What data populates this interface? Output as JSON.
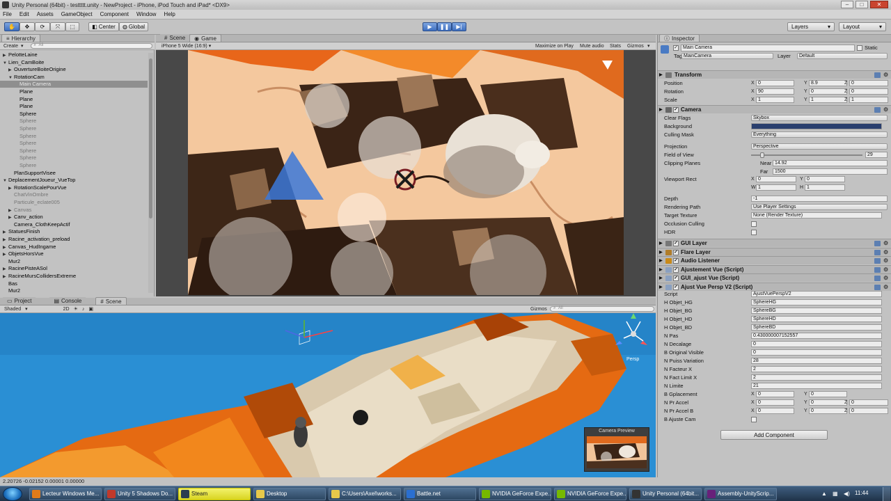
{
  "window": {
    "title": "Unity Personal (64bit) - testtttt.unity - NewProject - iPhone, iPod Touch and iPad* <DX9>",
    "controls": [
      "–",
      "□",
      "✕"
    ]
  },
  "menu": [
    "File",
    "Edit",
    "Assets",
    "GameObject",
    "Component",
    "Window",
    "Help"
  ],
  "toolbar": {
    "pivot": "Center",
    "space": "Global",
    "layers": "Layers",
    "layout": "Layout"
  },
  "hierarchy": {
    "tab": "Hierarchy",
    "create": "Create",
    "search": "All",
    "items": [
      {
        "label": "PelotteLaine",
        "arrow": "▶",
        "dim": false,
        "sel": false
      },
      {
        "label": "Lien_CamBoite",
        "arrow": "▼",
        "dim": false,
        "sel": false
      },
      {
        "label": "OuvertureBoiteOrigine",
        "arrow": "▶",
        "dim": false,
        "sel": false
      },
      {
        "label": "RotationCam",
        "arrow": "▼",
        "dim": false,
        "sel": false
      },
      {
        "label": "Main Camera",
        "arrow": "",
        "dim": false,
        "sel": true
      },
      {
        "label": "Plane",
        "arrow": "",
        "dim": false,
        "sel": false
      },
      {
        "label": "Plane",
        "arrow": "",
        "dim": false,
        "sel": false
      },
      {
        "label": "Plane",
        "arrow": "",
        "dim": false,
        "sel": false
      },
      {
        "label": "Sphere",
        "arrow": "",
        "dim": false,
        "sel": false
      },
      {
        "label": "Sphere",
        "arrow": "",
        "dim": true,
        "sel": false
      },
      {
        "label": "Sphere",
        "arrow": "",
        "dim": true,
        "sel": false
      },
      {
        "label": "Sphere",
        "arrow": "",
        "dim": true,
        "sel": false
      },
      {
        "label": "Sphere",
        "arrow": "",
        "dim": true,
        "sel": false
      },
      {
        "label": "Sphere",
        "arrow": "",
        "dim": true,
        "sel": false
      },
      {
        "label": "Sphere",
        "arrow": "",
        "dim": true,
        "sel": false
      },
      {
        "label": "Sphere",
        "arrow": "",
        "dim": true,
        "sel": false
      },
      {
        "label": "PlanSupportVisee",
        "arrow": "",
        "dim": false,
        "sel": false
      },
      {
        "label": "DeplacementJoueur_VueTop",
        "arrow": "▼",
        "dim": false,
        "sel": false
      },
      {
        "label": "RotationScalePourVue",
        "arrow": "▶",
        "dim": false,
        "sel": false
      },
      {
        "label": "ChatVinOmbre",
        "arrow": "",
        "dim": true,
        "sel": false
      },
      {
        "label": "Particule_eclate005",
        "arrow": "",
        "dim": true,
        "sel": false
      },
      {
        "label": "Canvas",
        "arrow": "▶",
        "dim": true,
        "sel": false
      },
      {
        "label": "Canv_action",
        "arrow": "▶",
        "dim": false,
        "sel": false
      },
      {
        "label": "Camera_ClothKeepActif",
        "arrow": "",
        "dim": false,
        "sel": false
      },
      {
        "label": "StatuesFinish",
        "arrow": "▶",
        "dim": false,
        "sel": false
      },
      {
        "label": "Racine_activation_preload",
        "arrow": "▶",
        "dim": false,
        "sel": false
      },
      {
        "label": "Canvas_HudIngame",
        "arrow": "▶",
        "dim": false,
        "sel": false
      },
      {
        "label": "ObjetsHorsVue",
        "arrow": "▶",
        "dim": false,
        "sel": false
      },
      {
        "label": "Mur2",
        "arrow": "",
        "dim": false,
        "sel": false
      },
      {
        "label": "RacinePisteASol",
        "arrow": "▶",
        "dim": false,
        "sel": false
      },
      {
        "label": "RacineMursCollidersExtreme",
        "arrow": "▶",
        "dim": false,
        "sel": false
      },
      {
        "label": "Bas",
        "arrow": "",
        "dim": false,
        "sel": false
      },
      {
        "label": "Mur2",
        "arrow": "",
        "dim": false,
        "sel": false
      }
    ]
  },
  "game": {
    "tabs": [
      "Scene",
      "Game"
    ],
    "aspect": "iPhone 5 Wide (16:9)",
    "options": [
      "Maximize on Play",
      "Mute audio",
      "Stats",
      "Gizmos"
    ]
  },
  "bottom": {
    "tabs": [
      "Project",
      "Console",
      "Scene"
    ],
    "shading": "Shaded",
    "mode2d": "2D",
    "gizmos": "Gizmos",
    "search": "All",
    "persp": "Persp",
    "preview_title": "Camera Preview"
  },
  "status": "2.20726 -0.02152 0.00001 0.00000",
  "inspector": {
    "tab": "Inspector",
    "object_name": "Main Camera",
    "static_label": "Static",
    "tag_label": "Tag",
    "tag_value": "MainCamera",
    "layer_label": "Layer",
    "layer_value": "Default",
    "transform": {
      "title": "Transform",
      "position_label": "Position",
      "position": [
        "0",
        "8.9",
        "0"
      ],
      "rotation_label": "Rotation",
      "rotation": [
        "90",
        "0",
        "0"
      ],
      "scale_label": "Scale",
      "scale": [
        "1",
        "1",
        "1"
      ]
    },
    "camera": {
      "title": "Camera",
      "clear_flags_label": "Clear Flags",
      "clear_flags": "Skybox",
      "background_label": "Background",
      "background_color": "#2a3f6e",
      "culling_label": "Culling Mask",
      "culling": "Everything",
      "projection_label": "Projection",
      "projection": "Perspective",
      "fov_label": "Field of View",
      "fov": "29",
      "fov_slider": 0.1,
      "clipping_label": "Clipping Planes",
      "near_label": "Near",
      "near": "14.92",
      "far_label": "Far",
      "far": "1500",
      "viewport_label": "Viewport Rect",
      "viewport": {
        "x": "0",
        "y": "0",
        "w": "1",
        "h": "1"
      },
      "depth_label": "Depth",
      "depth": "-1",
      "rendering_label": "Rendering Path",
      "rendering": "Use Player Settings",
      "target_label": "Target Texture",
      "target": "None (Render Texture)",
      "occlusion_label": "Occlusion Culling",
      "hdr_label": "HDR"
    },
    "components": [
      "GUI Layer",
      "Flare Layer",
      "Audio Listener",
      "Ajustement Vue (Script)",
      "GUI_ajust Vue (Script)",
      "Ajust Vue Persp V2 (Script)"
    ],
    "script": {
      "script_label": "Script",
      "script_value": "AjustVuePerspV2",
      "fields": [
        {
          "label": "H Objet_HG",
          "value": "SphereHG"
        },
        {
          "label": "H Objet_BG",
          "value": "SphereBG"
        },
        {
          "label": "H Objet_HD",
          "value": "SphereHD"
        },
        {
          "label": "H Objet_BD",
          "value": "SphereBD"
        },
        {
          "label": "N Pas",
          "value": "0.430000007152557"
        },
        {
          "label": "N Decalage",
          "value": "0"
        },
        {
          "label": "B Original Visible",
          "value": "0"
        },
        {
          "label": "N Puiss Variation",
          "value": "28"
        },
        {
          "label": "N Facteur X",
          "value": "2"
        },
        {
          "label": "N Fact Limit X",
          "value": "2"
        },
        {
          "label": "N Limite",
          "value": "21"
        }
      ],
      "gplacement_label": "B Gplacement",
      "gplacement": [
        "0",
        "0"
      ],
      "praccel_label": "N Pr Accel",
      "praccel": [
        "0",
        "0",
        "0"
      ],
      "praccelb_label": "N Pr Accel B",
      "praccelb": [
        "0",
        "0",
        "0"
      ],
      "ajuste_label": "B Ajuste Cam"
    },
    "add_component": "Add Component"
  },
  "taskbar": {
    "tasks": [
      {
        "label": "Lecteur Windows Me...",
        "color": "#e07b1a"
      },
      {
        "label": "Unity 5 Shadows Do...",
        "color": "#c0392b"
      },
      {
        "label": "Steam",
        "color": "#2c3e50"
      },
      {
        "label": "Desktop",
        "color": "#e7c94a"
      },
      {
        "label": "C:\\Users\\Axel\\works...",
        "color": "#e7c94a"
      },
      {
        "label": "Battle.net",
        "color": "#2a6fd1"
      },
      {
        "label": "NVIDIA GeForce Expe...",
        "color": "#76b900"
      },
      {
        "label": "NVIDIA GeForce Expe...",
        "color": "#76b900"
      },
      {
        "label": "Unity Personal (64bit...",
        "color": "#333333"
      },
      {
        "label": "Assembly-UnityScrip...",
        "color": "#68217a"
      }
    ],
    "clock": "11:44"
  }
}
